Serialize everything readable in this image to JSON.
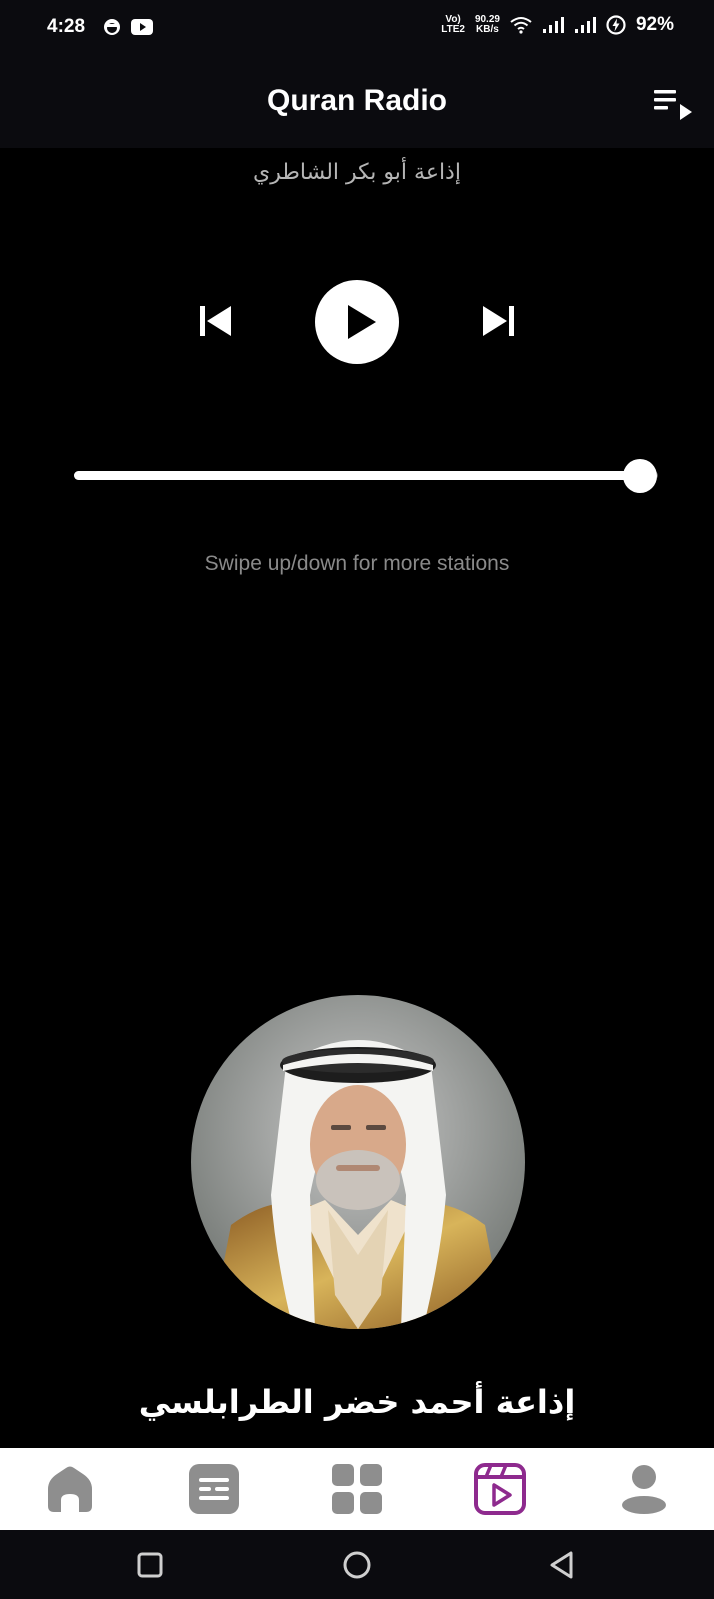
{
  "status_bar": {
    "time": "4:28",
    "network_type_top": "Vo)",
    "network_type_bottom": "LTE2",
    "speed_value": "90.29",
    "speed_unit": "KB/s",
    "battery": "92%"
  },
  "header": {
    "title": "Quran Radio"
  },
  "current_station": {
    "name": "إذاعة أبو بكر الشاطري"
  },
  "player": {
    "progress_fraction": 0.97
  },
  "hint_text": "Swipe up/down for more stations",
  "next_station": {
    "name": "إذاعة أحمد خضر الطرابلسي"
  },
  "colors": {
    "background": "#000000",
    "nav_background": "#ffffff",
    "nav_icon": "#8e8e8e",
    "nav_active": "#8e2a8e"
  },
  "bottom_nav": {
    "items": [
      "home-icon",
      "quran-icon",
      "grid-icon",
      "radio-icon",
      "profile-icon"
    ],
    "active": "radio-icon"
  }
}
